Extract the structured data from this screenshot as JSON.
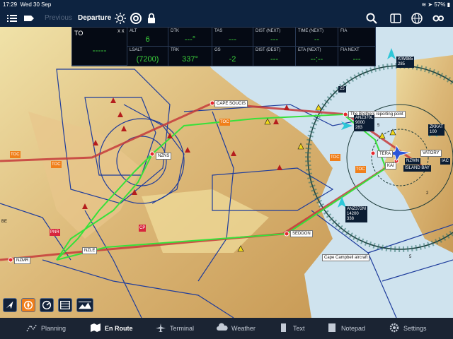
{
  "status_bar": {
    "time": "17:29",
    "date": "Wed 30 Sep",
    "battery": "57%"
  },
  "nav_bar": {
    "previous_label": "Previous",
    "title": "Departure"
  },
  "info_panel": {
    "to": {
      "label": "TO",
      "value": "-----",
      "unit_label": "X X"
    },
    "alt": {
      "label": "ALT",
      "value": "6"
    },
    "dtk": {
      "label": "DTK",
      "value": "---°"
    },
    "tas": {
      "label": "TAS",
      "value": "---"
    },
    "dist_next": {
      "label": "DIST (NEXT)",
      "value": "---"
    },
    "time_next": {
      "label": "TIME (NEXT)",
      "value": "--"
    },
    "fia": {
      "label": "FIA",
      "value": ""
    },
    "lsalt": {
      "label": "LSALT",
      "value": "(7200)"
    },
    "trk": {
      "label": "TRK",
      "value": "337°"
    },
    "gs": {
      "label": "GS",
      "value": "-2"
    },
    "dist_dest": {
      "label": "DIST (DEST)",
      "value": "---"
    },
    "eta_next": {
      "label": "ETA (NEXT)",
      "value": "--:--"
    },
    "fia_next": {
      "label": "FIA NEXT",
      "value": "---"
    }
  },
  "map": {
    "waypoints": [
      {
        "name": "CAPE SOUCIS"
      },
      {
        "name": "The Brothers reporting point"
      },
      {
        "name": "NZNS"
      },
      {
        "name": "SEDDON"
      },
      {
        "name": "NZMR"
      },
      {
        "name": "NZLE"
      },
      {
        "name": "TERA"
      },
      {
        "name": "VATORY"
      },
      {
        "name": "NZWN"
      },
      {
        "name": "KAI"
      },
      {
        "name": "ISLAND BAY"
      },
      {
        "name": "Cape Campbell aircraft"
      }
    ],
    "traffic": [
      {
        "callsign": "KIW985",
        "altitude": "285"
      },
      {
        "callsign": "ANZ370L",
        "altitude": "9000",
        "speed": "283"
      },
      {
        "callsign": "ZKKAT",
        "altitude": "100"
      },
      {
        "callsign": "ANZ372M",
        "altitude": "14200",
        "speed": "338"
      }
    ],
    "toc_labels": [
      "TOC",
      "TOC",
      "TOC",
      "TOC",
      "TOC"
    ],
    "ring_labels": [
      "25",
      "5",
      "5",
      "2"
    ],
    "misc_labels": [
      "BE",
      "PNR",
      "CP",
      "IAC"
    ]
  },
  "tabs": [
    {
      "label": "Planning"
    },
    {
      "label": "En Route"
    },
    {
      "label": "Terminal"
    },
    {
      "label": "Weather"
    },
    {
      "label": "Text"
    },
    {
      "label": "Notepad"
    },
    {
      "label": "Settings"
    }
  ],
  "colors": {
    "route": "#37e13a",
    "airspace": "#1e3c9c",
    "toc": "#f07f1a",
    "waypoint": "#e5272e",
    "panel_value": "#3bd23b",
    "accent_active": "#ffffff"
  }
}
